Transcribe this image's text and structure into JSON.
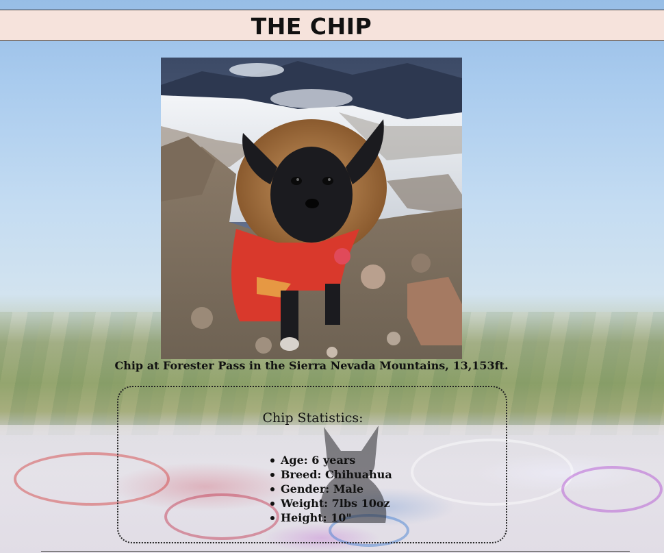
{
  "header": {
    "title": "THE CHIP"
  },
  "photo": {
    "caption": "Chip at Forester Pass in the Sierra Nevada Mountains, 13,153ft."
  },
  "stats": {
    "heading": "Chip Statistics:",
    "items": [
      "Age: 6 years",
      "Breed: Chihuahua",
      "Gender: Male",
      "Weight: 7lbs 10oz",
      "Height: 10\""
    ]
  },
  "colors": {
    "header_bg": "#f6e3dc",
    "sky": "#97bde6",
    "jacket": "#d9392c",
    "dog": "#1b1b1f"
  }
}
